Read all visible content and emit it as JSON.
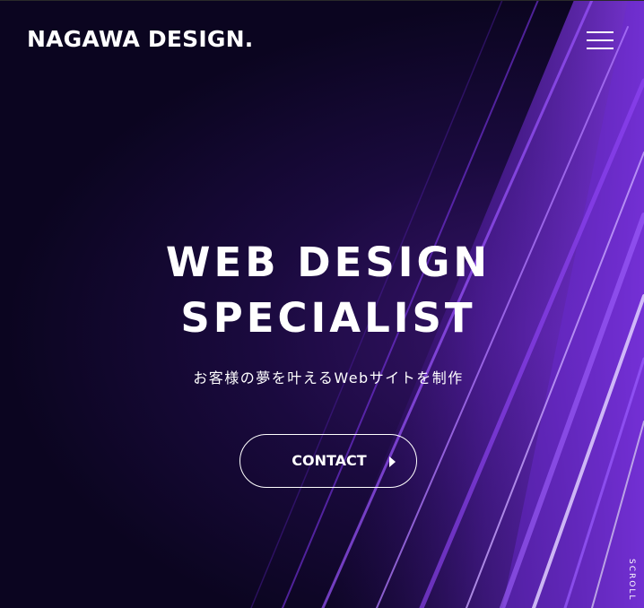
{
  "header": {
    "logo": "NAGAWA DESIGN.",
    "menu_icon": "hamburger-menu-icon"
  },
  "hero": {
    "headline_line1": "WEB DESIGN",
    "headline_line2": "SPECIALIST",
    "subtitle": "お客様の夢を叶えるWebサイトを制作",
    "cta_label": "CONTACT",
    "cta_icon": "triangle-right-icon",
    "scroll_label": "SCROLL"
  },
  "colors": {
    "background": "#0b0520",
    "accent_purple": "#7b2cf0",
    "text": "#ffffff"
  }
}
